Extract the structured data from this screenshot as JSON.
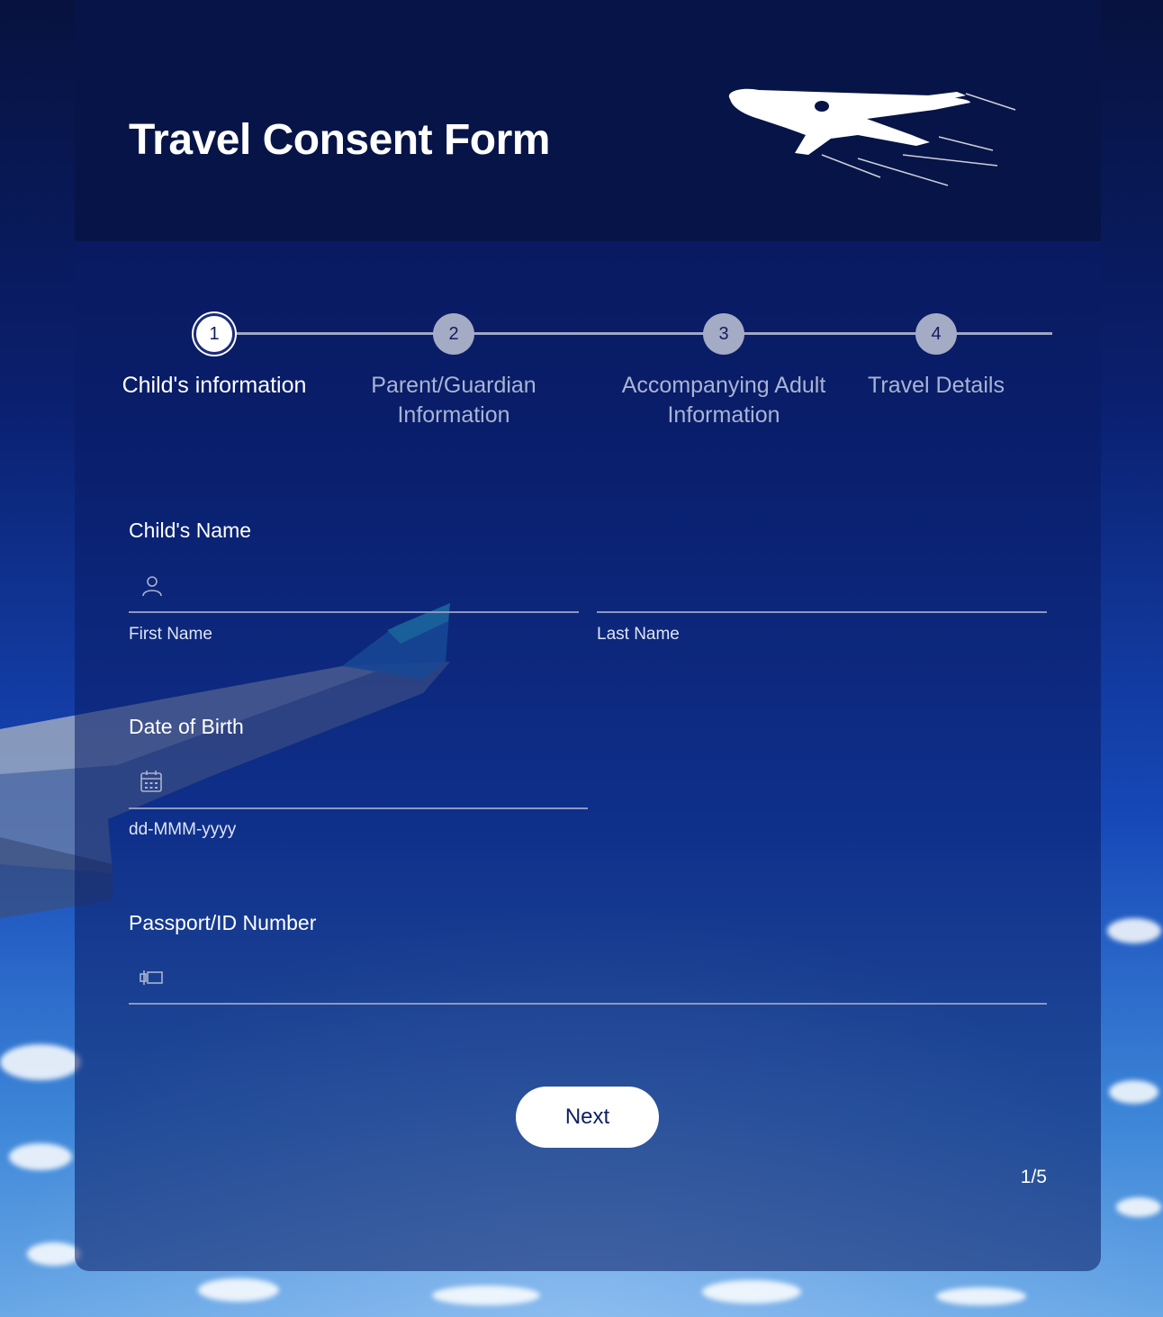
{
  "form": {
    "title": "Travel Consent Form"
  },
  "steps": [
    {
      "number": "1",
      "label": "Child's information",
      "active": true
    },
    {
      "number": "2",
      "label": "Parent/Guardian Information",
      "active": false
    },
    {
      "number": "3",
      "label": "Accompanying Adult Information",
      "active": false
    },
    {
      "number": "4",
      "label": "Travel Details",
      "active": false
    }
  ],
  "fields": {
    "child_name": {
      "label": "Child's Name",
      "first_name_sublabel": "First Name",
      "last_name_sublabel": "Last Name",
      "first_name_value": "",
      "last_name_value": ""
    },
    "dob": {
      "label": "Date of Birth",
      "sublabel": "dd-MMM-yyyy",
      "value": ""
    },
    "passport": {
      "label": "Passport/ID Number",
      "value": ""
    }
  },
  "actions": {
    "next_label": "Next"
  },
  "pagination": {
    "text": "1/5"
  },
  "icons": {
    "first_name": "user-icon",
    "dob": "calendar-icon",
    "passport": "id-card-icon",
    "header": "airplane-icon"
  },
  "colors": {
    "header_bg": "#071447",
    "accent": "#0c1f63",
    "step_inactive": "#a4abc4"
  }
}
